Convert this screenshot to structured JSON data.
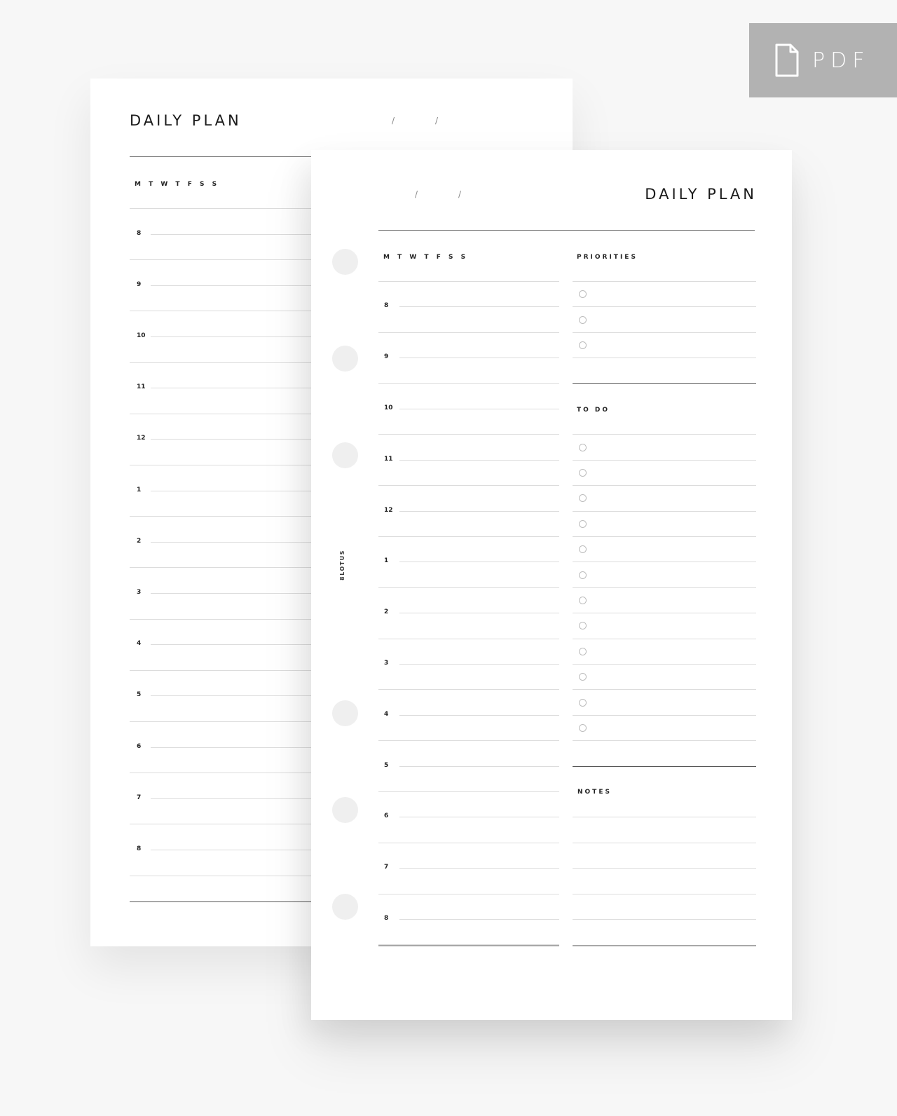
{
  "badge": {
    "label": "PDF",
    "icon": "file-icon",
    "color": "#b2b2b2"
  },
  "back_page": {
    "title": "DAILY PLAN",
    "date_separators": [
      "/",
      "/"
    ],
    "days_label": "M T W T F S S",
    "hours": [
      "8",
      "9",
      "10",
      "11",
      "12",
      "1",
      "2",
      "3",
      "4",
      "5",
      "6",
      "7",
      "8"
    ]
  },
  "front_page": {
    "title": "DAILY PLAN",
    "date_separators": [
      "/",
      "/"
    ],
    "days_label": "M T W T F S S",
    "hours": [
      "8",
      "9",
      "10",
      "11",
      "12",
      "1",
      "2",
      "3",
      "4",
      "5",
      "6",
      "7",
      "8"
    ],
    "brand": "8LOTUS",
    "priorities": {
      "label": "PRIORITIES",
      "count": 3
    },
    "todo": {
      "label": "TO DO",
      "count": 12
    },
    "notes": {
      "label": "NOTES"
    }
  }
}
